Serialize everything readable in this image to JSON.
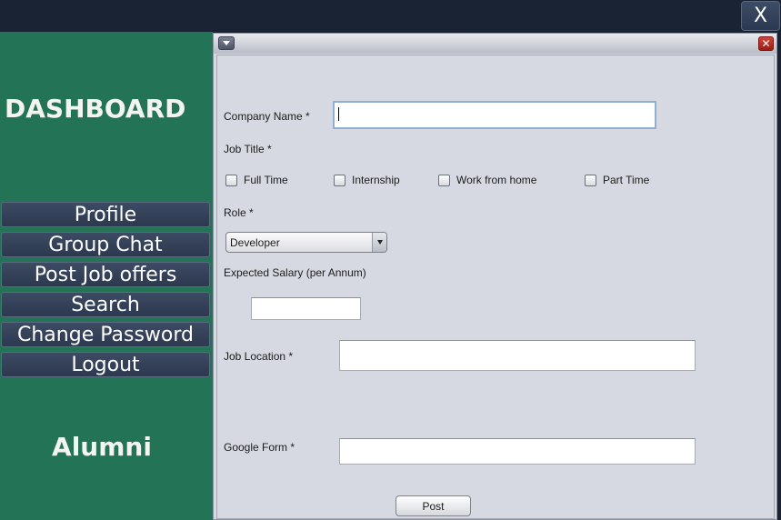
{
  "window": {
    "close_label": "X"
  },
  "sidebar": {
    "title": "DASHBOARD",
    "items": [
      {
        "label": "Profile"
      },
      {
        "label": "Group Chat"
      },
      {
        "label": "Post Job offers"
      },
      {
        "label": "Search"
      },
      {
        "label": "Change Password"
      },
      {
        "label": "Logout"
      }
    ],
    "footer": "Alumni"
  },
  "internal_frame": {
    "close_icon": "x-icon",
    "menu_icon": "triangle-down-icon"
  },
  "form": {
    "company_name": {
      "label": "Company Name *",
      "value": ""
    },
    "job_title": {
      "label": "Job Title *",
      "options": [
        {
          "label": "Full Time",
          "checked": false
        },
        {
          "label": "Internship",
          "checked": false
        },
        {
          "label": "Work from home",
          "checked": false
        },
        {
          "label": "Part Time",
          "checked": false
        }
      ]
    },
    "role": {
      "label": "Role *",
      "selected": "Developer"
    },
    "salary": {
      "label": "Expected Salary (per Annum)",
      "value": ""
    },
    "job_location": {
      "label": "Job Location *",
      "value": ""
    },
    "google_form": {
      "label": "Google Form *",
      "value": ""
    },
    "submit_label": "Post"
  },
  "colors": {
    "sidebar_bg": "#237456",
    "topbar_bg": "#1a2333",
    "nav_button_bg": "#2f3c53",
    "form_bg": "#d6d9e1"
  }
}
